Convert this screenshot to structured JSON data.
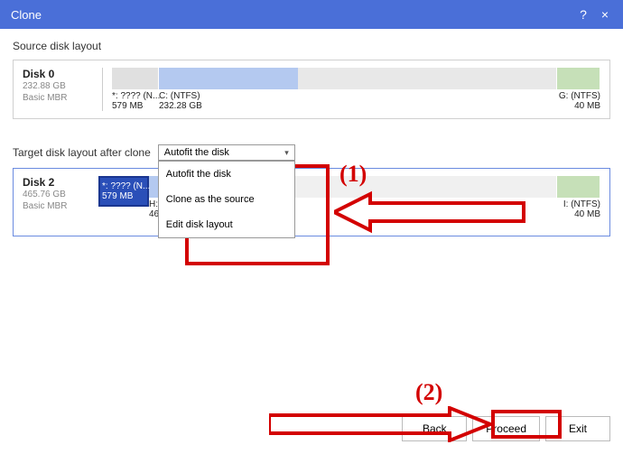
{
  "titlebar": {
    "title": "Clone"
  },
  "source": {
    "section_title": "Source disk layout",
    "disk": {
      "name": "Disk 0",
      "size": "232.88 GB",
      "type": "Basic MBR"
    },
    "parts": {
      "p0": {
        "label": "*: ???? (N...",
        "size": "579 MB"
      },
      "p1": {
        "label": "C: (NTFS)",
        "size": "232.28 GB"
      },
      "p2": {
        "label": "G: (NTFS)",
        "size": "40 MB"
      }
    }
  },
  "target": {
    "section_title": "Target disk layout after clone",
    "dropdown": {
      "selected": "Autofit the disk",
      "opts": {
        "o0": "Autofit the disk",
        "o1": "Clone as the source",
        "o2": "Edit disk layout"
      }
    },
    "disk": {
      "name": "Disk 2",
      "size": "465.76 GB",
      "type": "Basic MBR"
    },
    "parts": {
      "p0": {
        "label": "*: ???? (N...",
        "size": "579 MB"
      },
      "p1": {
        "label": "H: (...",
        "size": "46..."
      },
      "p2": {
        "label": "I: (NTFS)",
        "size": "40 MB"
      }
    }
  },
  "footer": {
    "back": "Back",
    "proceed": "Proceed",
    "exit": "Exit"
  },
  "annotations": {
    "label1": "(1)",
    "label2": "(2)"
  }
}
